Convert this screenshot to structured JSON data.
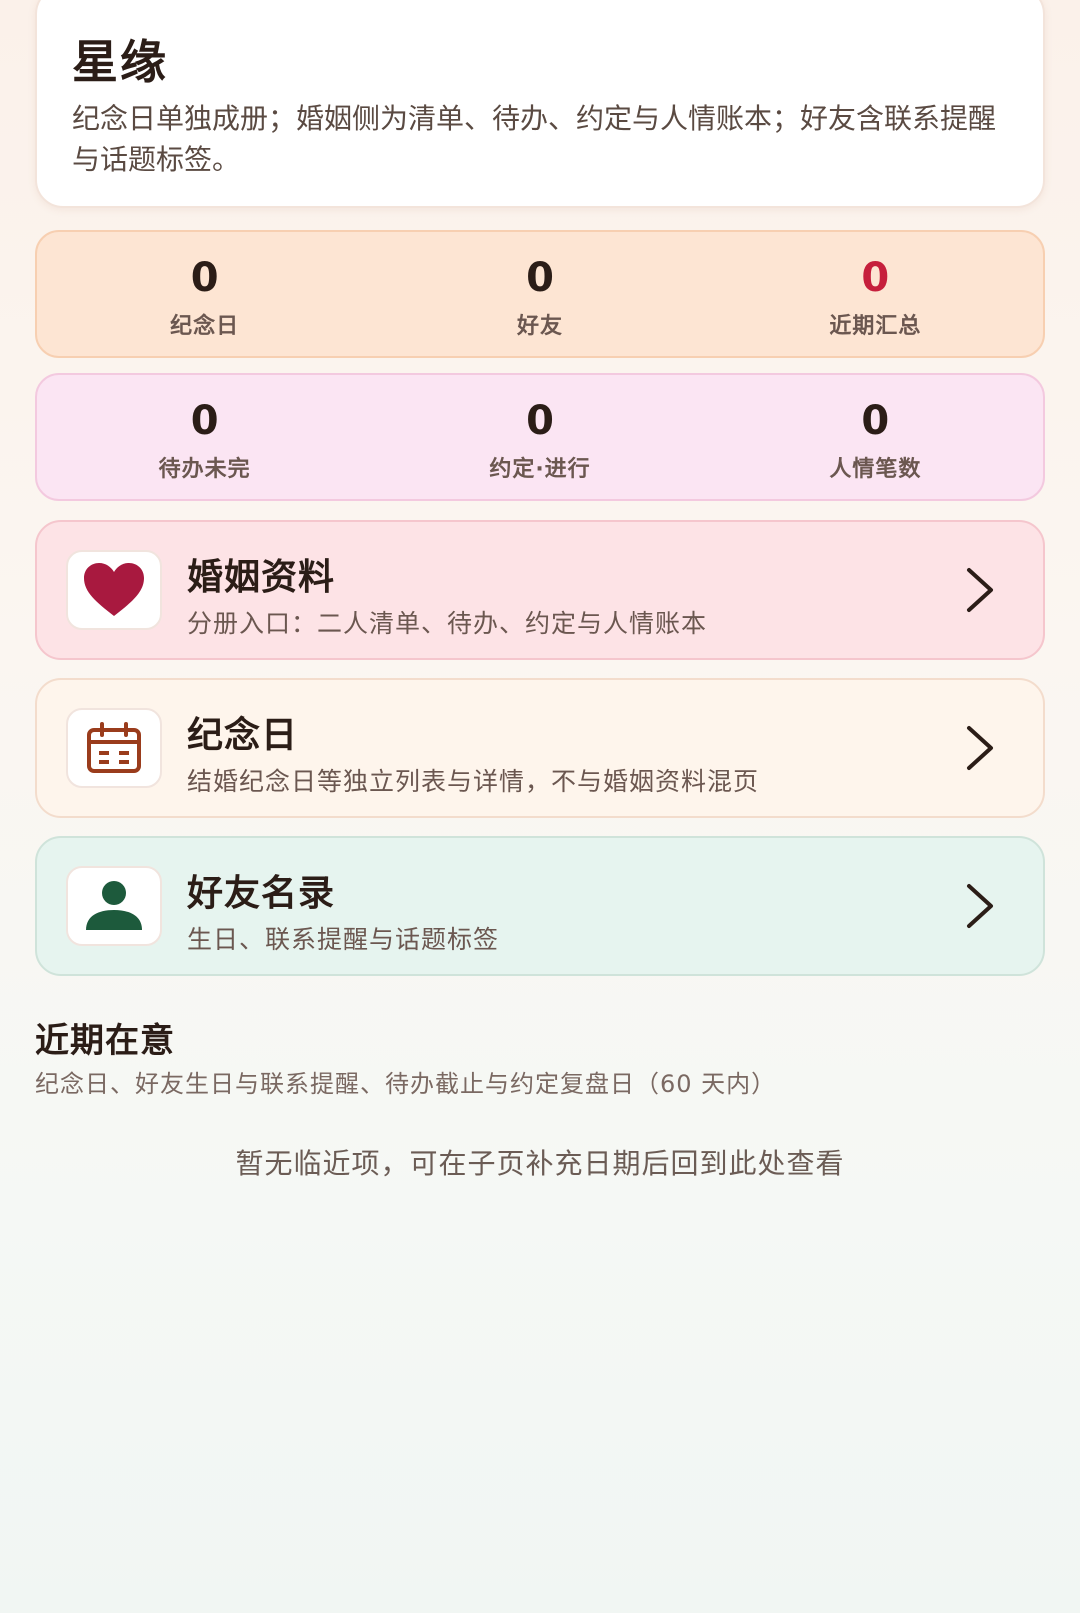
{
  "header": {
    "title": "星缘",
    "subtitle": "纪念日单独成册；婚姻侧为清单、待办、约定与人情账本；好友含联系提醒与话题标签。"
  },
  "stats_row1": [
    {
      "value": "0",
      "label": "纪念日"
    },
    {
      "value": "0",
      "label": "好友"
    },
    {
      "value": "0",
      "label": "近期汇总"
    }
  ],
  "stats_row2": [
    {
      "value": "0",
      "label": "待办未完"
    },
    {
      "value": "0",
      "label": "约定·进行"
    },
    {
      "value": "0",
      "label": "人情笔数"
    }
  ],
  "nav": {
    "marriage": {
      "title": "婚姻资料",
      "desc": "分册入口：二人清单、待办、约定与人情账本",
      "icon": "heart-icon",
      "color": "#a8193f"
    },
    "anniversary": {
      "title": "纪念日",
      "desc": "结婚纪念日等独立列表与详情，不与婚姻资料混页",
      "icon": "calendar-icon",
      "color": "#9a3c1c"
    },
    "friends": {
      "title": "好友名录",
      "desc": "生日、联系提醒与话题标签",
      "icon": "person-icon",
      "color": "#1d5a3c"
    }
  },
  "recent": {
    "title": "近期在意",
    "desc": "纪念日、好友生日与联系提醒、待办截止与约定复盘日（60 天内）",
    "empty": "暂无临近项，可在子页补充日期后回到此处查看"
  },
  "colors": {
    "highlight_red": "#c61f3c",
    "text_dark": "#2b1d17"
  }
}
